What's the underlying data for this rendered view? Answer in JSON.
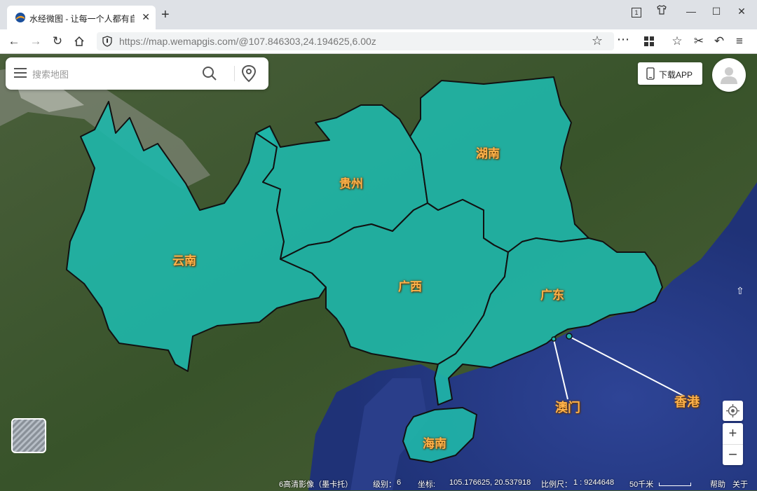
{
  "browser": {
    "tab_title": "水经微图 - 让每一个人都有自",
    "url_host": "https://map.wemapgis.com/",
    "url_path": "@107.846303,24.194625,6.00z",
    "tab_count": "1"
  },
  "search": {
    "placeholder": "搜索地图"
  },
  "download_label": "下载APP",
  "map": {
    "regions": [
      {
        "name": "云南"
      },
      {
        "name": "贵州"
      },
      {
        "name": "湖南"
      },
      {
        "name": "广西"
      },
      {
        "name": "广东"
      },
      {
        "name": "海南"
      }
    ],
    "callouts": [
      {
        "name": "澳门"
      },
      {
        "name": "香港"
      }
    ],
    "colors": {
      "region_fill": "#1fb5a8",
      "region_border": "#111111",
      "label": "#ffb24a",
      "sea": "#2b3f8c",
      "land": "#3e5a2e"
    }
  },
  "status": {
    "imagery": "6高清影像（墨卡托）",
    "level_label": "级别：",
    "level": "6",
    "coord_label": "坐标:",
    "coord": "105.176625, 20.537918",
    "scale_label": "比例尺：",
    "scale": "1 : 9244648",
    "scale_bar_label": "50千米",
    "help": "帮助",
    "about": "关于"
  }
}
